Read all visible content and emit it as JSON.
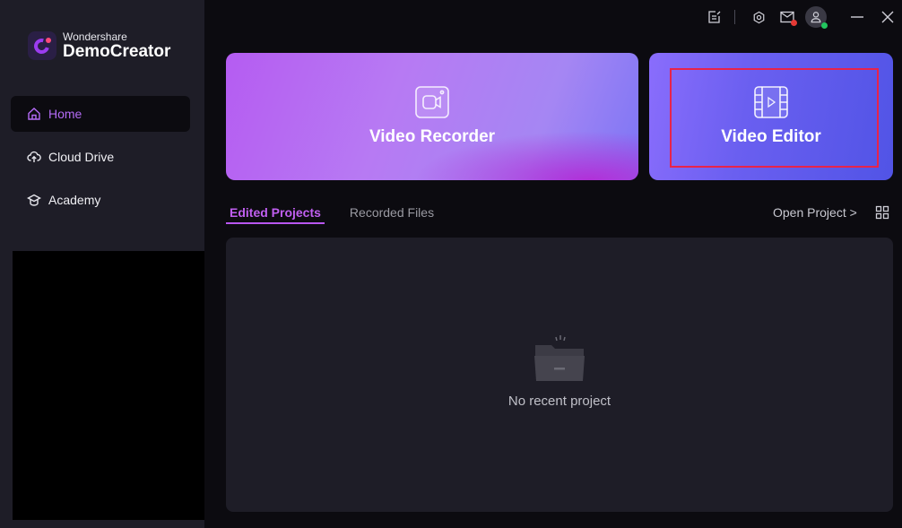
{
  "brand": {
    "company": "Wondershare",
    "product": "DemoCreator",
    "accent": "#b46bf6"
  },
  "sidebar": {
    "items": [
      {
        "label": "Home",
        "icon": "home-icon",
        "active": true
      },
      {
        "label": "Cloud Drive",
        "icon": "cloud-upload-icon",
        "active": false
      },
      {
        "label": "Academy",
        "icon": "graduation-cap-icon",
        "active": false
      }
    ]
  },
  "topbar": {
    "icons": [
      "feedback-icon",
      "settings-icon",
      "mail-icon",
      "avatar-icon",
      "minimize-icon",
      "close-icon"
    ],
    "mail_badge_color": "#e53935",
    "status_dot_color": "#22c55e"
  },
  "cards": {
    "recorder": {
      "label": "Video Recorder",
      "icon": "camera-icon"
    },
    "editor": {
      "label": "Video Editor",
      "icon": "film-icon"
    }
  },
  "tabs": [
    {
      "label": "Edited Projects",
      "active": true
    },
    {
      "label": "Recorded Files",
      "active": false
    }
  ],
  "open_project_label": "Open Project >",
  "empty_state": {
    "text": "No recent project",
    "icon": "folder-icon"
  }
}
